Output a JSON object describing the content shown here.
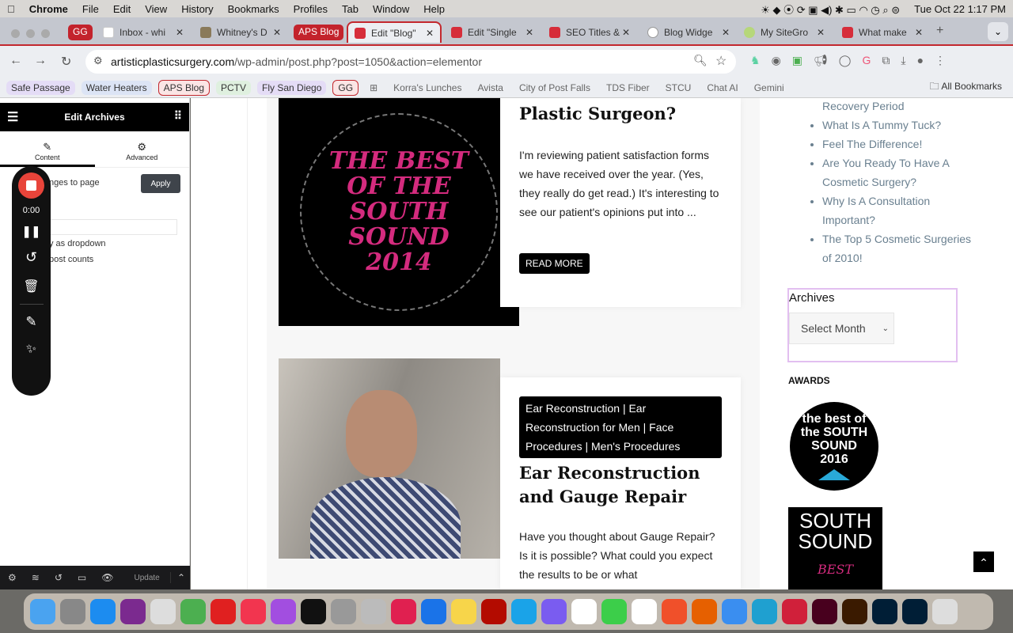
{
  "menubar": {
    "app": "Chrome",
    "items": [
      "File",
      "Edit",
      "View",
      "History",
      "Bookmarks",
      "Profiles",
      "Tab",
      "Window",
      "Help"
    ],
    "datetime": "Tue Oct 22  1:17 PM"
  },
  "tabs": [
    {
      "group": "GG"
    },
    {
      "label": "Inbox - whi"
    },
    {
      "label": "Whitney's D"
    },
    {
      "group": "APS Blog"
    },
    {
      "label": "Edit \"Blog\"",
      "active": true
    },
    {
      "label": "Edit \"Single"
    },
    {
      "label": "SEO Titles &"
    },
    {
      "label": "Blog Widge"
    },
    {
      "label": "My SiteGro"
    },
    {
      "label": "What make"
    }
  ],
  "address": {
    "domain": "artisticplasticsurgery.com",
    "path": "/wp-admin/post.php?post=1050&action=elementor"
  },
  "bookmarks": [
    "Safe Passage",
    "Water Heaters",
    "APS Blog",
    "PCTV",
    "Fly San Diego",
    "GG",
    "Korra's Lunches",
    "Avista",
    "City of Post Falls",
    "TDS Fiber",
    "STCU",
    "Chat AI",
    "Gemini"
  ],
  "all_bookmarks": "All Bookmarks",
  "panel": {
    "title": "Edit Archives",
    "tab_content": "Content",
    "tab_advanced": "Advanced",
    "apply_text": "nges to page",
    "apply": "Apply",
    "opt1": "y as dropdown",
    "opt2": "post counts",
    "update": "Update"
  },
  "recorder": {
    "time": "0:00"
  },
  "posts": [
    {
      "title": "Plastic Surgeon?",
      "excerpt": "I'm reviewing patient satisfaction forms we have received over the year. (Yes, they really do get read.) It's interesting to see our patient's opinions put into ...",
      "read_more": "READ MORE",
      "image_text": "THE BEST OF THE SOUTH SOUND 2014"
    },
    {
      "categories": "Ear Reconstruction | Ear Reconstruction for Men | Face Procedures | Men's Procedures",
      "title": "Ear Reconstruction and Gauge Repair",
      "excerpt": "Have you thought about Gauge Repair?  Is it is possible? What could you expect the results to be or what"
    }
  ],
  "sidebar": {
    "recent": [
      "Recovery Period",
      "What Is A Tummy Tuck?",
      "Feel The Difference!",
      "Are You Ready To Have A Cosmetic Surgery?",
      "Why Is A Consultation Important?",
      "The Top 5 Cosmetic Surgeries of 2010!"
    ],
    "archives_title": "Archives",
    "archives_select": "Select Month",
    "awards_title": "AWARDS",
    "award1": "the best of the SOUTH SOUND 2016",
    "award2": "SOUTH SOUND"
  },
  "dock": [
    "Finder",
    "System Settings",
    "App Store",
    "Power",
    "Launchpad",
    "Roboform",
    "YouTube Music",
    "Music",
    "Podcasts",
    "Screenshot",
    "Calculator",
    "Dictionary",
    "Affinity",
    "Dropbox",
    "Notes",
    "Acrobat",
    "ClickUp",
    "Perplexity",
    "Slack",
    "Messages",
    "Chrome",
    "Brave",
    "Firefox",
    "Safari",
    "Edge",
    "Opera",
    "InDesign",
    "Illustrator",
    "Photoshop",
    "Lightroom Classic",
    "Trash"
  ]
}
